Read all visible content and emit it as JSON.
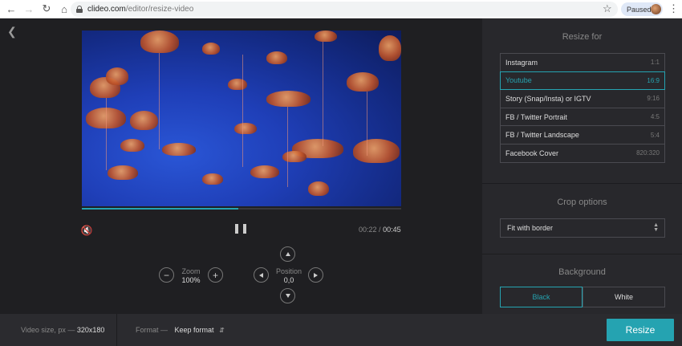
{
  "browser": {
    "url_host": "clideo.com",
    "url_path": "/editor/resize-video",
    "profile_status": "Paused"
  },
  "player": {
    "current_time": "00:22",
    "time_separator": "/",
    "total_time": "00:45",
    "progress_fraction": 0.49
  },
  "zoom": {
    "label": "Zoom",
    "value": "100%"
  },
  "position": {
    "label": "Position",
    "value": "0,0"
  },
  "panel": {
    "resize_title": "Resize for",
    "presets": [
      {
        "label": "Instagram",
        "ratio": "1:1",
        "active": false
      },
      {
        "label": "Youtube",
        "ratio": "16:9",
        "active": true
      },
      {
        "label": "Story (Snap/Insta) or IGTV",
        "ratio": "9:16",
        "active": false
      },
      {
        "label": "FB / Twitter Portrait",
        "ratio": "4:5",
        "active": false
      },
      {
        "label": "FB / Twitter Landscape",
        "ratio": "5:4",
        "active": false
      },
      {
        "label": "Facebook Cover",
        "ratio": "820:320",
        "active": false
      }
    ],
    "crop_title": "Crop options",
    "crop_value": "Fit with border",
    "background_title": "Background",
    "background_options": [
      "Black",
      "White"
    ],
    "background_selected": "Black"
  },
  "footer": {
    "video_size_label": "Video size, px —",
    "video_size_value": "320x180",
    "format_label": "Format —",
    "format_value": "Keep format",
    "resize_label": "Resize"
  },
  "colors": {
    "accent": "#25a3b1",
    "background": "#1f1f22",
    "panel": "#28282c"
  }
}
